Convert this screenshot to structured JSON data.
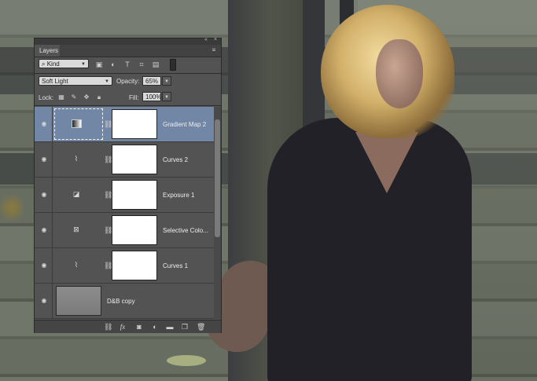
{
  "panel": {
    "collapse_icon": "double-chevron-icon",
    "close_icon": "close-icon",
    "tab": "Layers",
    "menu_icon": "panel-menu-icon"
  },
  "filter": {
    "kind": "Kind",
    "icons": [
      "pixel-filter-icon",
      "adjustment-filter-icon",
      "type-filter-icon",
      "shape-filter-icon",
      "smart-object-filter-icon"
    ]
  },
  "blend": {
    "mode": "Soft Light",
    "opacity_label": "Opacity:",
    "opacity_value": "65%"
  },
  "lock": {
    "label": "Lock:",
    "icons": [
      "lock-transparency-icon",
      "lock-paint-icon",
      "lock-position-icon",
      "lock-all-icon"
    ],
    "fill_label": "Fill:",
    "fill_value": "100%"
  },
  "layers": [
    {
      "name": "Gradient Map 2",
      "icon": "gradient-map-icon",
      "selected": true,
      "visible": true
    },
    {
      "name": "Curves 2",
      "icon": "curves-icon",
      "selected": false,
      "visible": true
    },
    {
      "name": "Exposure 1",
      "icon": "exposure-icon",
      "selected": false,
      "visible": true
    },
    {
      "name": "Selective Colo...",
      "icon": "selective-color-icon",
      "selected": false,
      "visible": true
    },
    {
      "name": "Curves 1",
      "icon": "curves-icon",
      "selected": false,
      "visible": true
    },
    {
      "name": "D&B copy",
      "icon": "image-thumbnail",
      "selected": false,
      "visible": true
    }
  ],
  "bottom_icons": [
    "link-layers-icon",
    "fx-icon",
    "add-mask-icon",
    "new-adjustment-icon",
    "new-group-icon",
    "new-layer-icon",
    "trash-icon"
  ],
  "colors": {
    "selected_row": "#7287a5",
    "panel_bg": "#535353"
  }
}
